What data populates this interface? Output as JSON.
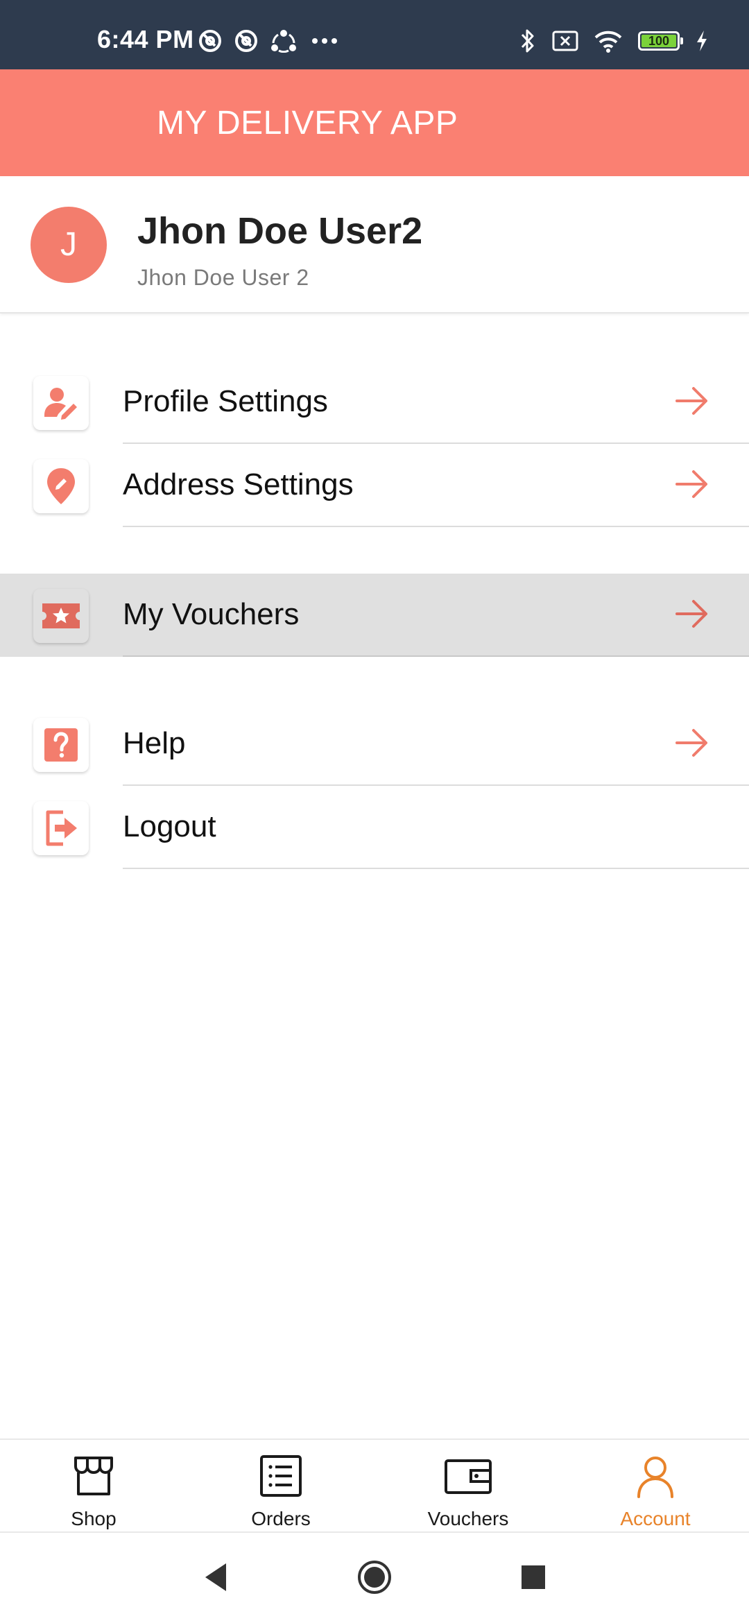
{
  "status_bar": {
    "time": "6:44 PM",
    "battery_level": "100"
  },
  "header": {
    "title": "MY DELIVERY APP"
  },
  "profile": {
    "avatar_initial": "J",
    "name": "Jhon Doe User2",
    "subtitle": "Jhon Doe User 2"
  },
  "menu": [
    {
      "label": "Profile Settings",
      "icon": "user-edit-icon",
      "arrow": true
    },
    {
      "label": "Address Settings",
      "icon": "map-pin-icon",
      "arrow": true
    },
    {
      "label": "My Vouchers",
      "icon": "ticket-star-icon",
      "arrow": true,
      "highlighted": true
    },
    {
      "label": "Help",
      "icon": "question-icon",
      "arrow": true
    },
    {
      "label": "Logout",
      "icon": "logout-icon",
      "arrow": false
    }
  ],
  "bottom_nav": [
    {
      "label": "Shop",
      "icon": "shop-icon",
      "active": false
    },
    {
      "label": "Orders",
      "icon": "list-icon",
      "active": false
    },
    {
      "label": "Vouchers",
      "icon": "wallet-icon",
      "active": false
    },
    {
      "label": "Account",
      "icon": "user-icon",
      "active": true
    }
  ],
  "colors": {
    "header": "#fa8072",
    "accent": "#f07c6c",
    "active_nav": "#e8832a",
    "status_bar": "#2e3b4e",
    "highlight_row": "#e0e0e0"
  }
}
